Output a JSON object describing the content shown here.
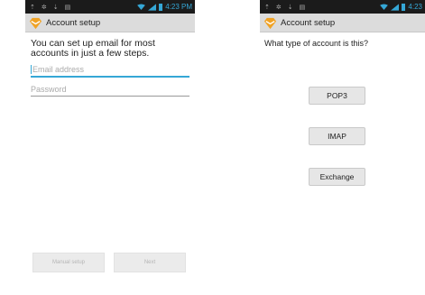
{
  "left_screen": {
    "status": {
      "icons_left": [
        "⇡",
        "✲",
        "⇣",
        "▤"
      ],
      "time": "4:23 PM"
    },
    "title": "Account setup",
    "intro": "You can set up email for most accounts in just a few steps.",
    "email_placeholder": "Email address",
    "password_placeholder": "Password",
    "manual_setup_label": "Manual setup",
    "next_label": "Next"
  },
  "right_screen": {
    "status": {
      "icons_left": [
        "⇡",
        "✲",
        "⇣",
        "▤"
      ],
      "time": "4:23"
    },
    "title": "Account setup",
    "question": "What type of account is this?",
    "options": [
      "POP3",
      "IMAP",
      "Exchange"
    ]
  },
  "colors": {
    "accent": "#35a7d6",
    "titlebar": "#dcdcdc",
    "statusbar": "#1b1b1b"
  },
  "icons": {
    "app": "email-setup-icon",
    "wifi": "wifi-icon",
    "signal": "signal-icon",
    "battery": "battery-icon"
  }
}
